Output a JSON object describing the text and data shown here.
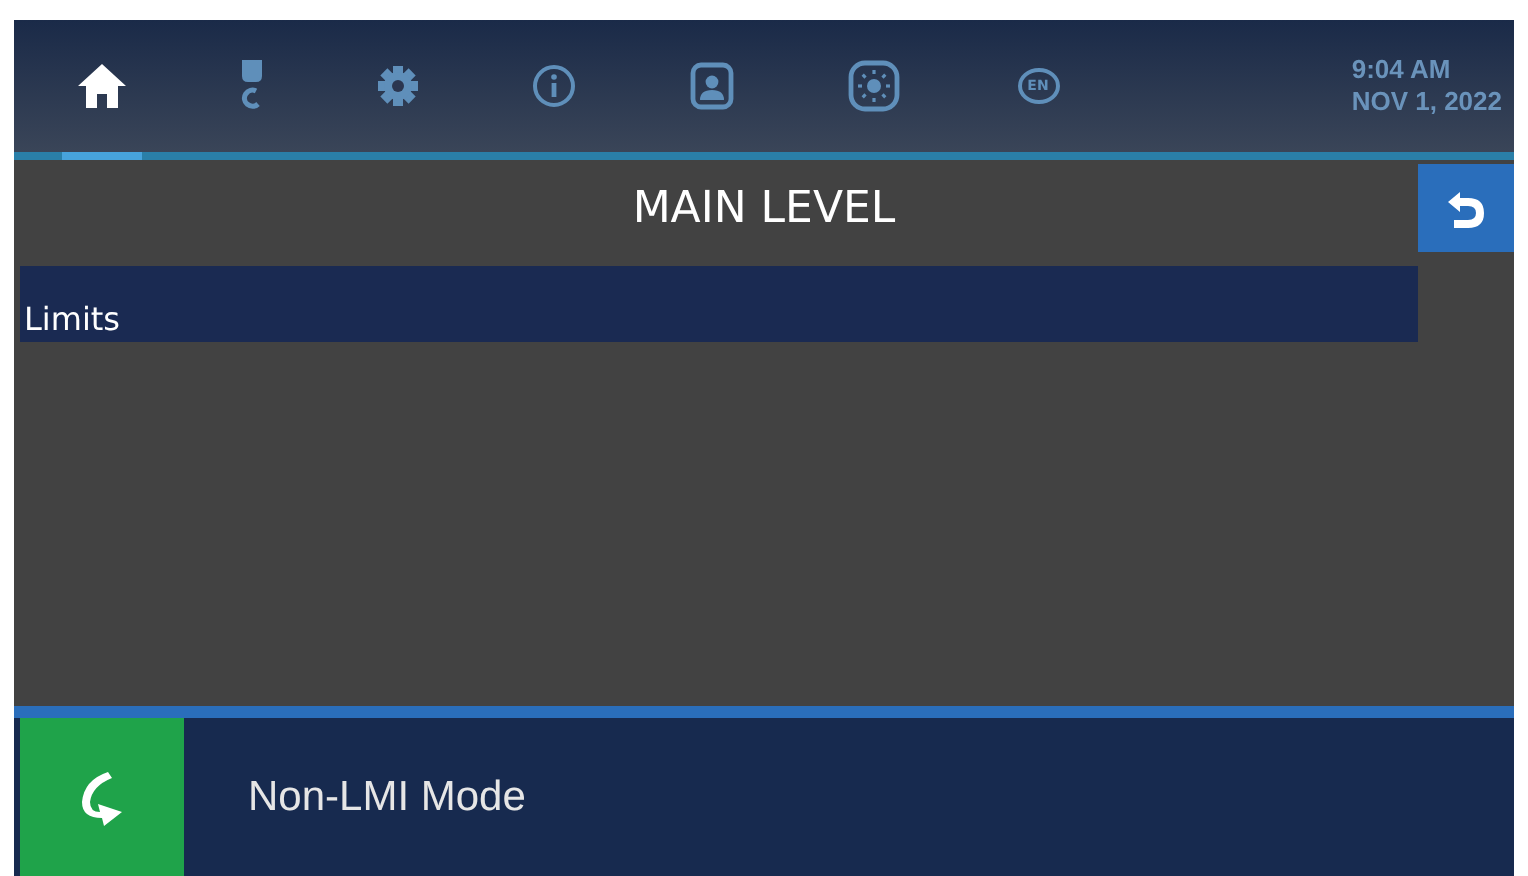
{
  "tabs": [
    {
      "kind": "home",
      "selected": true
    },
    {
      "kind": "hook",
      "selected": false
    },
    {
      "kind": "gear",
      "selected": false
    },
    {
      "kind": "info",
      "selected": false
    },
    {
      "kind": "person",
      "selected": false
    },
    {
      "kind": "brightness",
      "selected": false
    },
    {
      "kind": "language",
      "selected": false,
      "label": "EN"
    }
  ],
  "clock": {
    "time": "9:04 AM",
    "date": "NOV 1, 2022"
  },
  "title": "MAIN LEVEL",
  "list": {
    "items": [
      {
        "label": "Limits",
        "selected": true
      }
    ]
  },
  "footer": {
    "mode": "Non-LMI Mode"
  }
}
